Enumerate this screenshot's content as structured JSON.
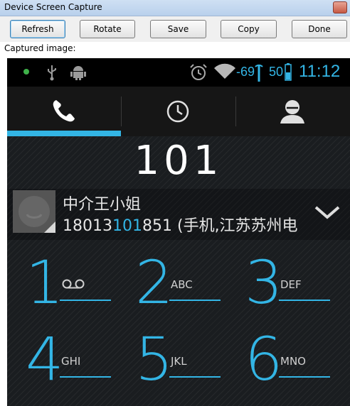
{
  "window": {
    "title": "Device Screen Capture"
  },
  "toolbar": {
    "refresh": "Refresh",
    "rotate": "Rotate",
    "save": "Save",
    "copy": "Copy",
    "done": "Done"
  },
  "caption": "Captured image:",
  "status": {
    "signal": "-69",
    "battery": "50",
    "time": "11:12"
  },
  "dialer": {
    "digits": "101",
    "contact_name": "中介王小姐",
    "number_before": "18013",
    "number_match": "101",
    "number_after": "851 (手机,江苏苏州电"
  },
  "keys": [
    {
      "digit": "1",
      "letters": ""
    },
    {
      "digit": "2",
      "letters": "ABC"
    },
    {
      "digit": "3",
      "letters": "DEF"
    },
    {
      "digit": "4",
      "letters": "GHI"
    },
    {
      "digit": "5",
      "letters": "JKL"
    },
    {
      "digit": "6",
      "letters": "MNO"
    }
  ],
  "colors": {
    "accent": "#33b5e5",
    "window_bg": "#f0f0f0",
    "screen_bg": "#000000"
  },
  "icons": [
    "notification-dot-icon",
    "usb-icon",
    "android-icon",
    "alarm-icon",
    "wifi-icon",
    "signal-icon",
    "phone-icon",
    "clock-icon",
    "contact-icon",
    "chevron-down-icon",
    "voicemail-icon"
  ]
}
